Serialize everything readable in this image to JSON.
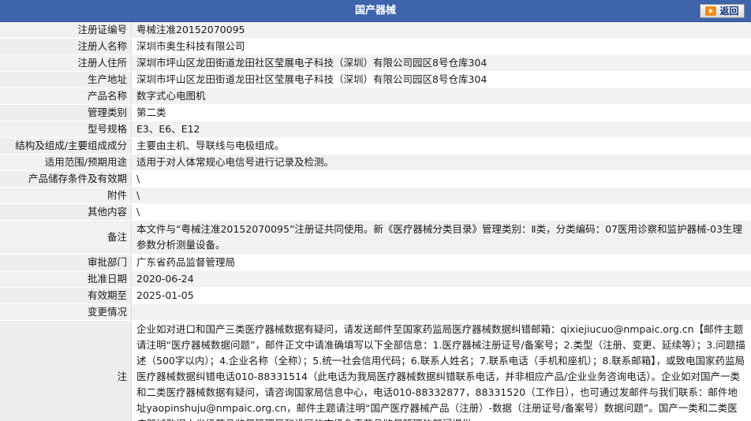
{
  "header": {
    "title": "国产器械",
    "back_label": "返回"
  },
  "rows": [
    {
      "label": "注册证编号",
      "value": "粤械注准20152070095"
    },
    {
      "label": "注册人名称",
      "value": "深圳市奥生科技有限公司"
    },
    {
      "label": "注册人住所",
      "value": "深圳市坪山区龙田街道龙田社区莹展电子科技（深圳）有限公司园区8号仓库304"
    },
    {
      "label": "生产地址",
      "value": "深圳市坪山区龙田街道龙田社区莹展电子科技（深圳）有限公司园区8号仓库304"
    },
    {
      "label": "产品名称",
      "value": "数字式心电图机"
    },
    {
      "label": "管理类别",
      "value": "第二类"
    },
    {
      "label": "型号规格",
      "value": "E3、E6、E12"
    },
    {
      "label": "结构及组成/主要组成成分",
      "value": "主要由主机、导联线与电极组成。"
    },
    {
      "label": "适用范围/预期用途",
      "value": "适用于对人体常规心电信号进行记录及检测。"
    },
    {
      "label": "产品储存条件及有效期",
      "value": "\\"
    },
    {
      "label": "附件",
      "value": "\\"
    },
    {
      "label": "其他内容",
      "value": "\\"
    },
    {
      "label": "备注",
      "value": "本文件与“粤械注准20152070095”注册证共同使用。新《医疗器械分类目录》管理类别：Ⅱ类，分类编码：07医用诊察和监护器械-03生理参数分析测量设备。"
    },
    {
      "label": "审批部门",
      "value": "广东省药品监督管理局"
    },
    {
      "label": "批准日期",
      "value": "2020-06-24"
    },
    {
      "label": "有效期至",
      "value": "2025-01-05"
    },
    {
      "label": "变更情况",
      "value": ""
    },
    {
      "label": "注",
      "value": "企业如对进口和国产三类医疗器械数据有疑问，请发送邮件至国家药监局医疗器械数据纠错邮箱：qixiejiucuo@nmpaic.org.cn【邮件主题请注明“医疗器械数据问题”，邮件正文中请准确填写以下全部信息：1.医疗器械注册证号/备案号；2.类型（注册、变更、延续等）；3.问题描述（500字以内）；4.企业名称（全称）；5.统一社会信用代码；6.联系人姓名；7.联系电话（手机和座机）；8.联系邮箱】，或致电国家药监局医疗器械数据纠错电话010-88331514（此电话为我局医疗器械数据纠错联系电话，并非相应产品/企业业务咨询电话）。企业如对国产一类和二类医疗器械数据有疑问，请咨询国家局信息中心，电话010-88332877，88331520（工作日），也可通过发邮件与我们联系：邮件地址yaopinshuju@nmpaic.org.cn，邮件主题请注明“国产医疗器械产品（注册）-数据（注册证号/备案号）数据问题”。国产一类和二类医疗器械数据由省级药品监督管理局和设区的市级负责药品监督管理的部门提供。"
    }
  ]
}
